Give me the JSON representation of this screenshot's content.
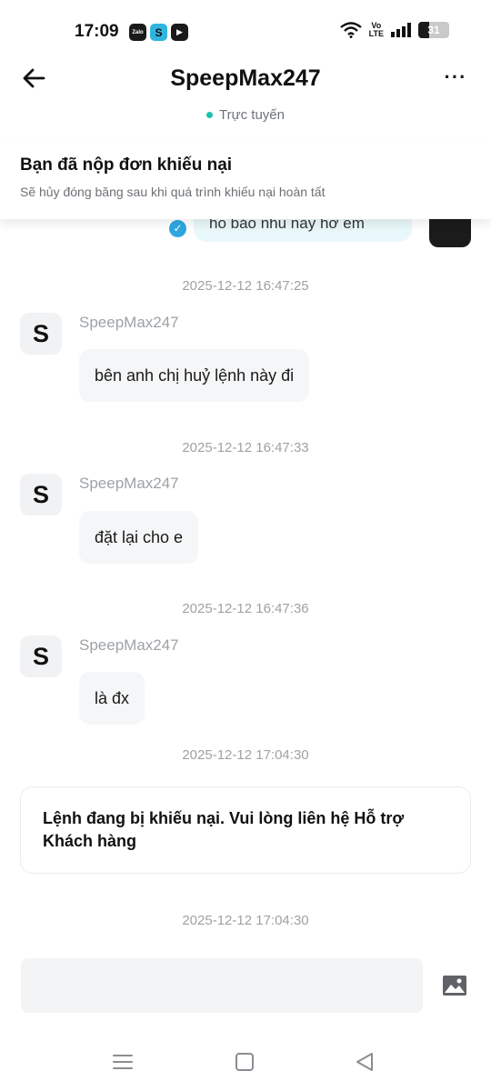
{
  "status_bar": {
    "time": "17:09",
    "app_icons": [
      {
        "name": "zalo-icon",
        "label": "Zalo"
      },
      {
        "name": "speed-app-icon",
        "label": "S"
      },
      {
        "name": "youtube-icon",
        "label": "▶"
      }
    ],
    "volte_top": "Vo",
    "volte_bottom": "LTE",
    "battery_level": "31",
    "icons": [
      "wifi-icon",
      "signal-icon",
      "battery-icon"
    ]
  },
  "header": {
    "title": "SpeepMax247",
    "status": "Trực tuyến",
    "back_icon": "arrow-left-icon",
    "more_icon": "more-options-icon",
    "more_label": "···",
    "status_color": "#1fbfb0"
  },
  "banner": {
    "title": "Bạn đã nộp đơn khiếu nại",
    "subtitle": "Sẽ hủy đóng băng sau khi quá trình khiếu nại hoàn tất"
  },
  "peek_message": {
    "text": "ho bảo nhu này hơ em",
    "status_icon": "check-circle-icon"
  },
  "messages": [
    {
      "timestamp": "2025-12-12 16:47:25",
      "avatar": "S",
      "sender": "SpeepMax247",
      "text": "bên anh chị huỷ lệnh này đi"
    },
    {
      "timestamp": "2025-12-12 16:47:33",
      "avatar": "S",
      "sender": "SpeepMax247",
      "text": "đặt lại cho e"
    },
    {
      "timestamp": "2025-12-12 16:47:36",
      "avatar": "S",
      "sender": "SpeepMax247",
      "text": "là đx"
    }
  ],
  "system_notice": {
    "timestamp": "2025-12-12 17:04:30",
    "text": "Lệnh đang bị khiếu nại. Vui lòng liên hệ Hỗ trợ Khách hàng"
  },
  "last_timestamp": "2025-12-12 17:04:30",
  "input": {
    "value": "",
    "placeholder": "",
    "image_icon": "image-icon"
  },
  "nav": {
    "icons": [
      "menu-icon",
      "home-icon",
      "back-icon"
    ]
  },
  "colors": {
    "accent": "#2ea7e0",
    "bubble_bg": "#f5f6f7",
    "peek_bubble_bg": "#e9f8fa"
  }
}
